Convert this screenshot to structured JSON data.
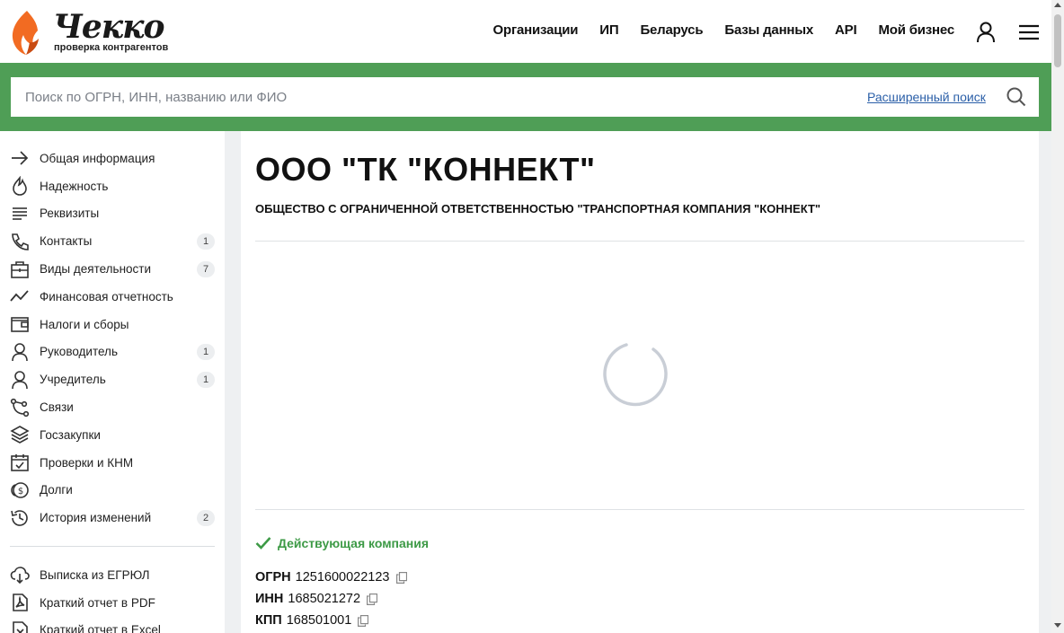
{
  "header": {
    "logo_text": "Чекко",
    "logo_subtitle": "проверка контрагентов",
    "nav": [
      "Организации",
      "ИП",
      "Беларусь",
      "Базы данных",
      "API",
      "Мой бизнес"
    ],
    "user_icon": "user-icon",
    "menu_icon": "hamburger-menu-icon"
  },
  "search": {
    "placeholder": "Поиск по ОГРН, ИНН, названию или ФИО",
    "advanced_label": "Расширенный поиск",
    "icon": "search-icon"
  },
  "sidebar": {
    "items": [
      {
        "label": "Общая информация",
        "icon": "arrow-right-icon",
        "badge": ""
      },
      {
        "label": "Надежность",
        "icon": "flame-icon",
        "badge": ""
      },
      {
        "label": "Реквизиты",
        "icon": "lines-icon",
        "badge": ""
      },
      {
        "label": "Контакты",
        "icon": "phone-icon",
        "badge": "1"
      },
      {
        "label": "Виды деятельности",
        "icon": "briefcase-icon",
        "badge": "7"
      },
      {
        "label": "Финансовая отчетность",
        "icon": "trend-line-icon",
        "badge": ""
      },
      {
        "label": "Налоги и сборы",
        "icon": "wallet-icon",
        "badge": ""
      },
      {
        "label": "Руководитель",
        "icon": "person-icon",
        "badge": "1"
      },
      {
        "label": "Учредитель",
        "icon": "person-icon",
        "badge": "1"
      },
      {
        "label": "Связи",
        "icon": "connections-icon",
        "badge": ""
      },
      {
        "label": "Госзакупки",
        "icon": "layers-icon",
        "badge": ""
      },
      {
        "label": "Проверки и КНМ",
        "icon": "calendar-check-icon",
        "badge": ""
      },
      {
        "label": "Долги",
        "icon": "coins-icon",
        "badge": ""
      },
      {
        "label": "История изменений",
        "icon": "history-icon",
        "badge": "2"
      }
    ],
    "reports": [
      {
        "label": "Выписка из ЕГРЮЛ",
        "icon": "cloud-download-icon"
      },
      {
        "label": "Краткий отчет в PDF",
        "icon": "pdf-file-icon"
      },
      {
        "label": "Краткий отчет в Excel",
        "icon": "excel-file-icon"
      }
    ]
  },
  "company": {
    "short_name": "ООО \"ТК \"КОННЕКТ\"",
    "full_name": "ОБЩЕСТВО С ОГРАНИЧЕННОЙ ОТВЕТСТВЕННОСТЬЮ \"ТРАНСПОРТНАЯ КОМПАНИЯ \"КОННЕКТ\"",
    "status": "Действующая компания",
    "status_color": "#3d9a46",
    "requisites": [
      {
        "label": "ОГРН",
        "value": "1251600022123"
      },
      {
        "label": "ИНН",
        "value": "1685021272"
      },
      {
        "label": "КПП",
        "value": "168501001"
      }
    ]
  },
  "colors": {
    "brand_green": "#4f9e56",
    "link_blue": "#2b5fa8",
    "logo_orange": "#f26b22"
  }
}
